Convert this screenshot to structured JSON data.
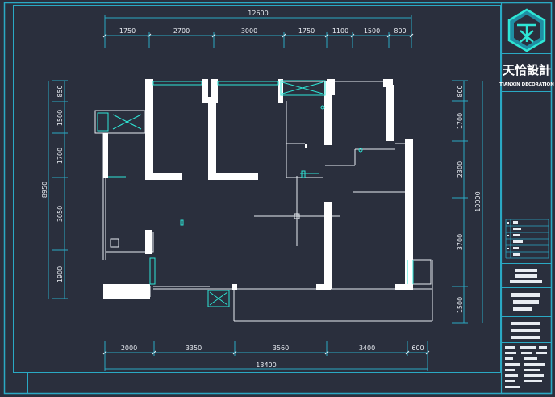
{
  "colors": {
    "background": "#2a2f3d",
    "frame": "#2aa9c4",
    "dimension_line": "#2aa9c4",
    "wall": "#ffffff",
    "fixture": "#2ee6d6"
  },
  "dimensions": {
    "top_total": "12600",
    "top_segments": [
      "1750",
      "2700",
      "3000",
      "1750",
      "1100",
      "1500",
      "800"
    ],
    "bottom_segments": [
      "2000",
      "3350",
      "3560",
      "3400",
      "600"
    ],
    "bottom_total": "13400",
    "left_total": "8950",
    "left_segments": [
      "850",
      "1500",
      "1700",
      "3050",
      "1900"
    ],
    "right_total": "10000",
    "right_segments": [
      "800",
      "1700",
      "2300",
      "3700",
      "1500"
    ]
  },
  "title_block": {
    "logo_icon": "tx-monogram-icon",
    "brand_name": "天恰設計",
    "brand_subtitle": "TIANXIN DECORATION"
  }
}
